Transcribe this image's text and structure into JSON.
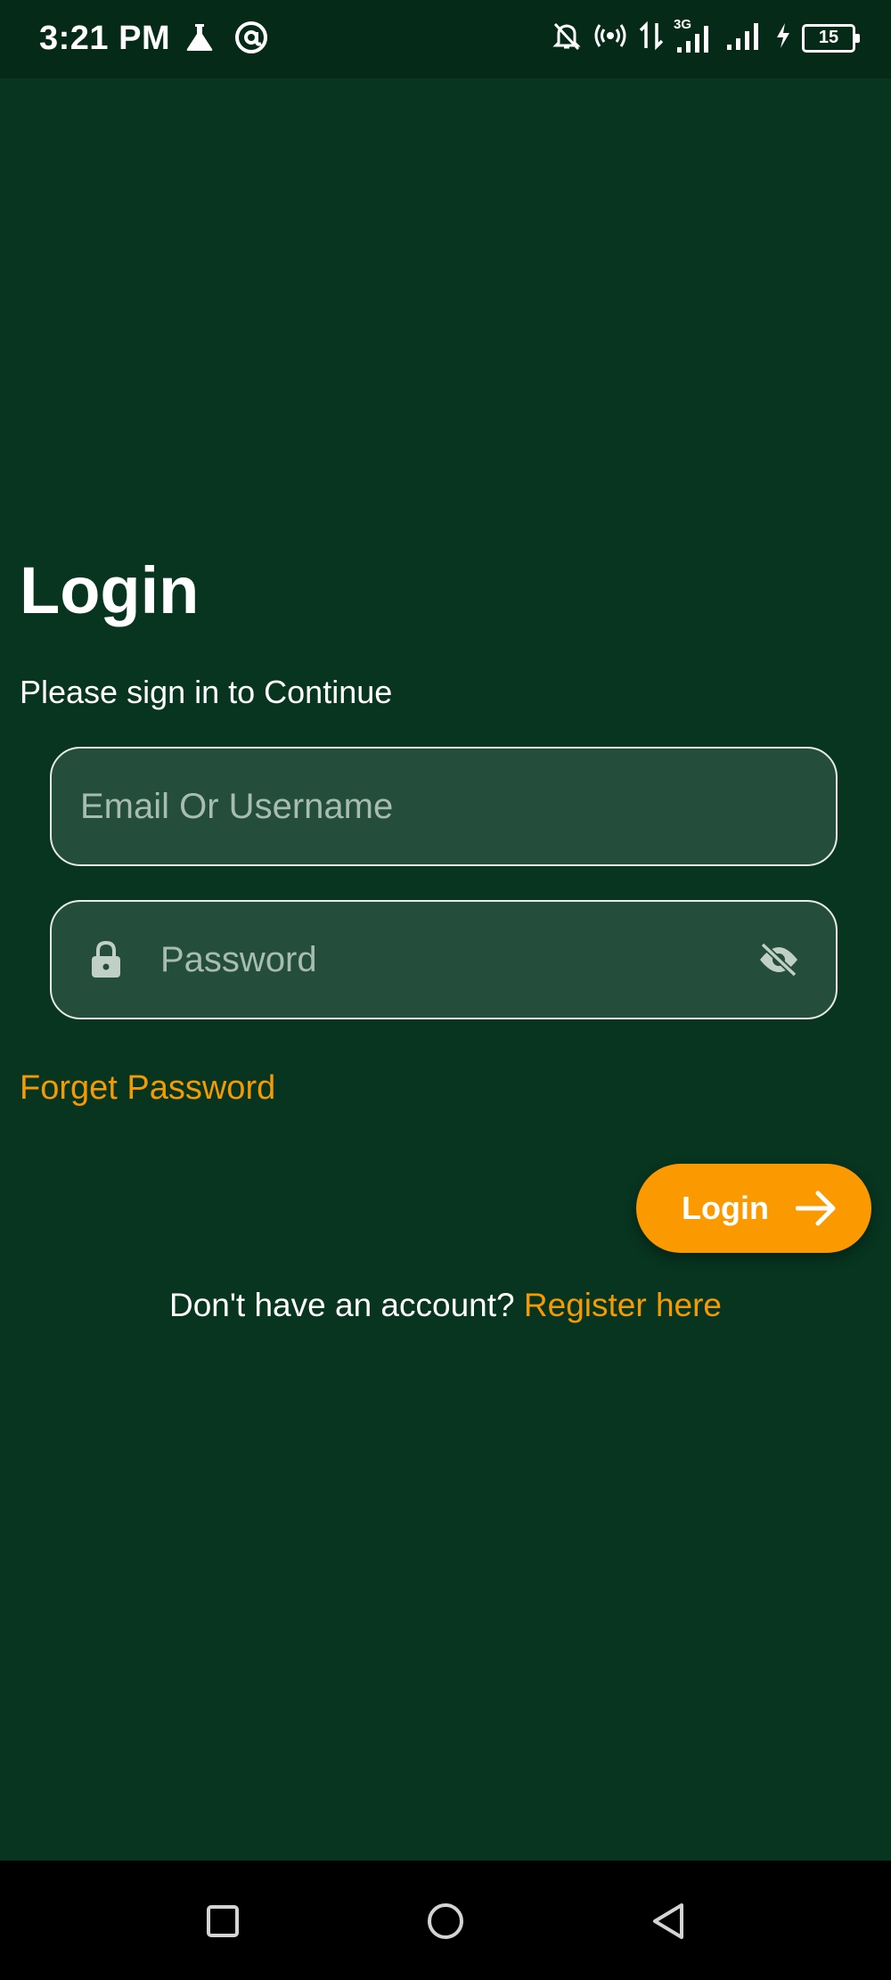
{
  "status_bar": {
    "time": "3:21 PM",
    "network_type": "3G",
    "battery_level": "15",
    "icons": [
      "flask-icon",
      "at-sign-icon",
      "bell-off-icon",
      "hotspot-icon",
      "data-arrows-icon",
      "signal-icon",
      "signal-icon",
      "charging-icon",
      "battery-icon"
    ]
  },
  "login": {
    "title": "Login",
    "subtitle": "Please sign in to Continue",
    "email_placeholder": "Email Or Username",
    "password_placeholder": "Password",
    "forgot_label": "Forget Password",
    "button_label": "Login",
    "register_prompt": "Don't have an account?",
    "register_link": "Register here"
  },
  "colors": {
    "background": "#073520",
    "field_background": "#244d3c",
    "accent": "#fb9900",
    "link": "#f59a00"
  },
  "nav_bar": {
    "icons": [
      "recents-square-icon",
      "home-circle-icon",
      "back-triangle-icon"
    ]
  }
}
